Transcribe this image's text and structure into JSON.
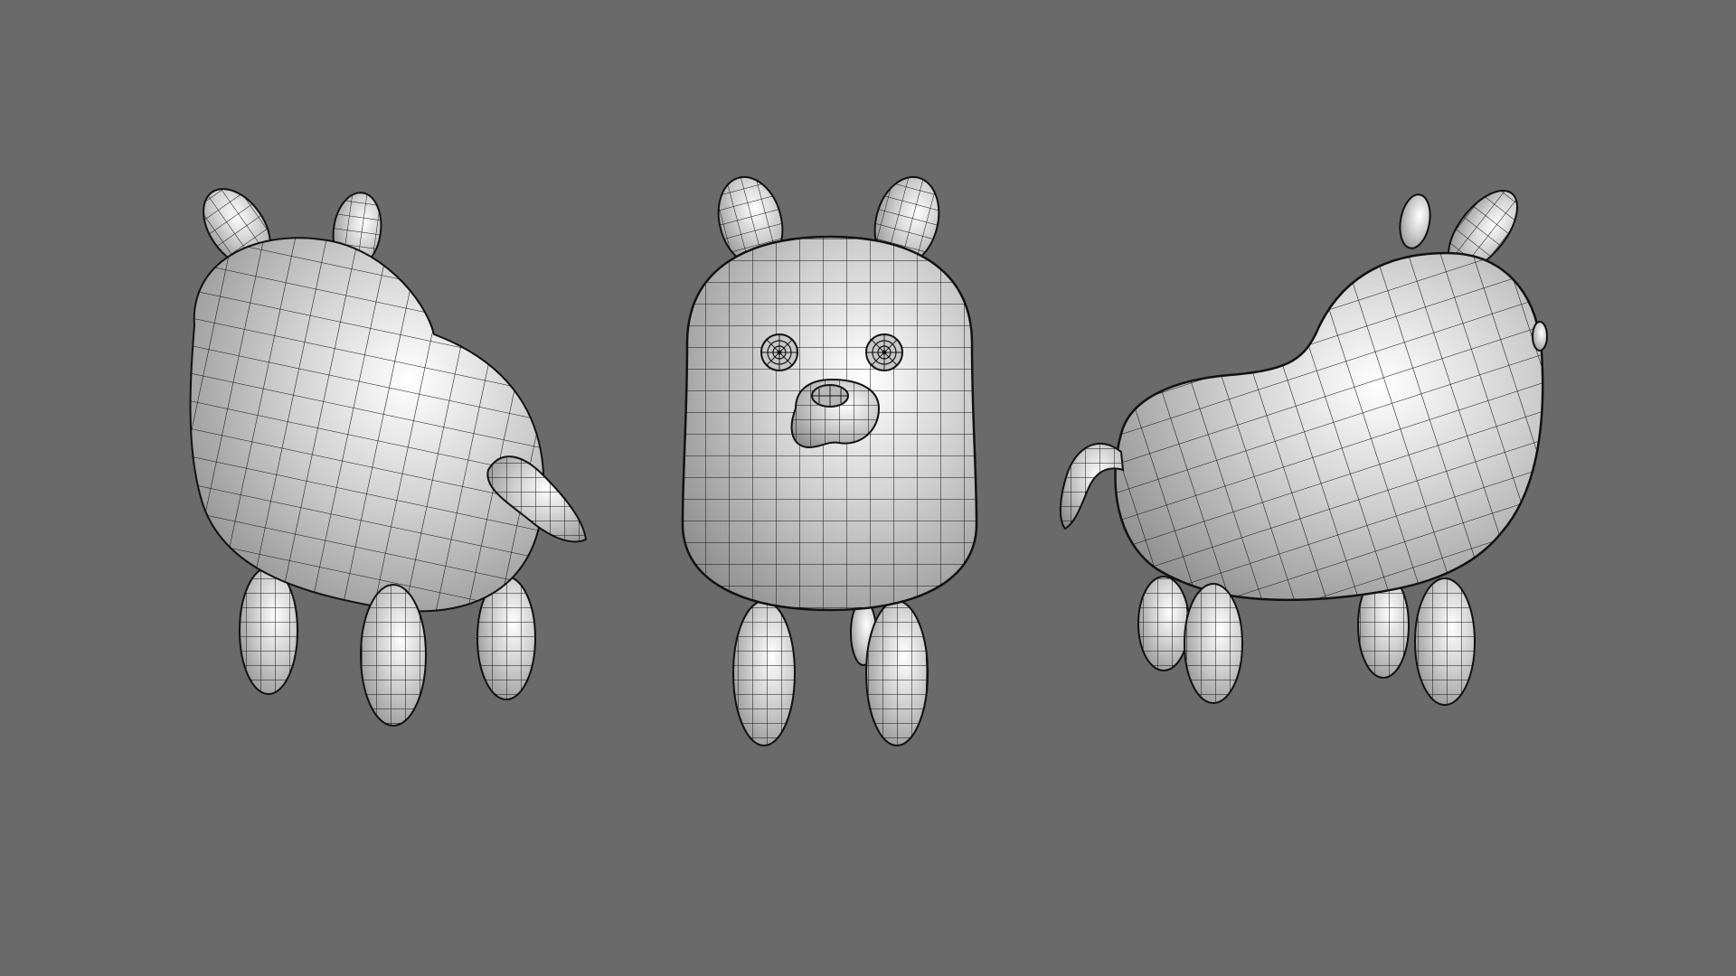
{
  "viewport": {
    "background": "#6a6a6a",
    "display_mode": "smooth-shaded-wireframe-on-shaded"
  },
  "model": {
    "object": "dog",
    "views": [
      "back-three-quarter",
      "front",
      "side-three-quarter"
    ],
    "surface_color": "#c8c8c8",
    "wire_color": "#111111"
  }
}
